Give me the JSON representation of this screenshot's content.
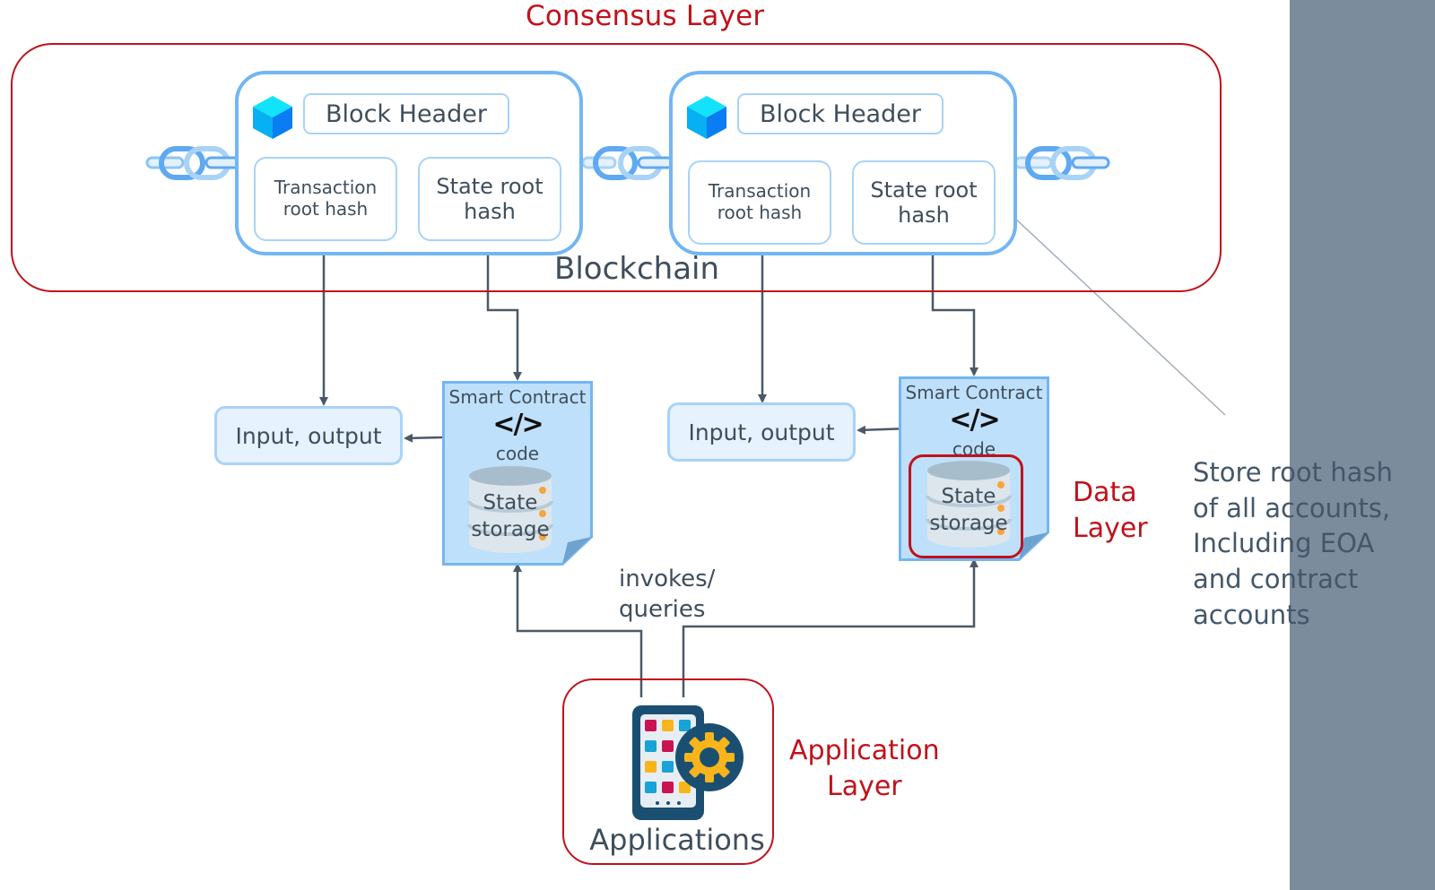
{
  "layers": {
    "consensus": "Consensus Layer",
    "data": [
      "Data",
      "Layer"
    ],
    "application": [
      "Application",
      "Layer"
    ]
  },
  "blockchain_label": "Blockchain",
  "blocks": [
    {
      "header": "Block Header",
      "transaction_root": [
        "Transaction",
        "root hash"
      ],
      "state_root": [
        "State root",
        "hash"
      ]
    },
    {
      "header": "Block Header",
      "transaction_root": [
        "Transaction",
        "root hash"
      ],
      "state_root": [
        "State root",
        "hash"
      ]
    }
  ],
  "io_boxes": [
    {
      "label": "Input, output"
    },
    {
      "label": "Input, output"
    }
  ],
  "contracts": [
    {
      "title": "Smart Contract",
      "code_icon": "</>",
      "code_label": "code",
      "storage": [
        "State",
        "storage"
      ],
      "highlighted": false
    },
    {
      "title": "Smart Contract",
      "code_icon": "</>",
      "code_label": "code",
      "storage": [
        "State",
        "storage"
      ],
      "highlighted": true
    }
  ],
  "invokes_label": [
    "invokes/",
    "queries"
  ],
  "applications_label": "Applications",
  "annotation": [
    "Store root hash",
    "of all accounts,",
    "Including EOA",
    "and contract",
    "accounts"
  ],
  "colors": {
    "layer_red": "#c0121b",
    "block_border": "#72b6f4",
    "inner_border": "#a8d3f8",
    "io_fill": "#e6f2fd",
    "contract_fill": "#bfe0fb",
    "text": "#3f4e5c",
    "arrow": "#4a5967",
    "side_panel": "#7b8c9c",
    "app_navy": "#1b4f72",
    "app_gear": "#f8b51b",
    "app_tile_red": "#cc1352",
    "app_tile_blue": "#17a3d6"
  }
}
